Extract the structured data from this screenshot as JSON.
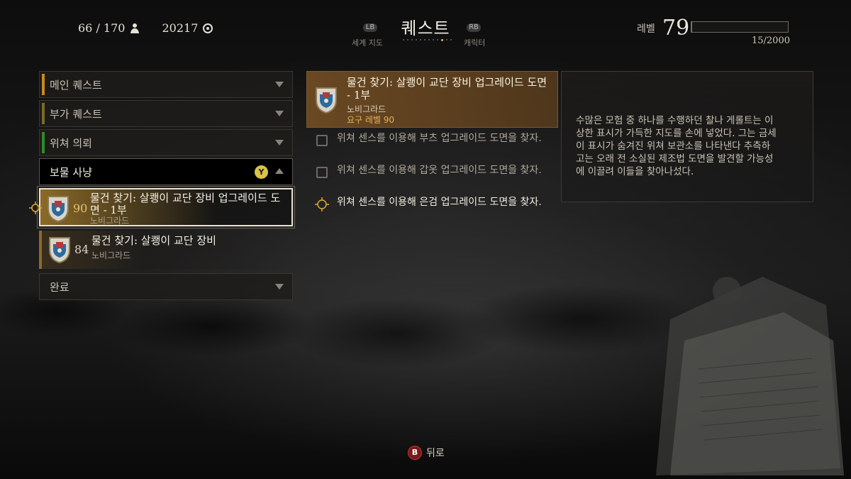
{
  "hud": {
    "inventory": "66 / 170",
    "gold": "20217",
    "title": "퀘스트",
    "nav_left_button": "LB",
    "nav_left_label": "세계 지도",
    "nav_right_button": "RB",
    "nav_right_label": "캐릭터",
    "level_label": "레벨",
    "level": "79",
    "xp": "15/2000",
    "xp_fraction": 0.0075
  },
  "categories": [
    {
      "label": "메인 퀘스트",
      "accent": "#c7891d"
    },
    {
      "label": "부가 퀘스트",
      "accent": "#7a6a28"
    },
    {
      "label": "위쳐 의뢰",
      "accent": "#2f8a2a"
    },
    {
      "label": "보물 사냥",
      "button": "Y"
    },
    {
      "label": "완료"
    }
  ],
  "quests": [
    {
      "level": "90",
      "name": "물건 찾기: 살쾡이 교단 장비 업그레이드 도면 - 1부",
      "location": "노비그라드"
    },
    {
      "level": "84",
      "name": "물건 찾기: 살쾡이 교단 장비",
      "location": "노비그라드"
    }
  ],
  "detail": {
    "title": "물건 찾기: 살쾡이 교단 장비 업그레이드 도면 - 1부",
    "location": "노비그라드",
    "required_level": "요구 레벨 90",
    "objectives": [
      "위쳐 센스를 이용해 부츠 업그레이드 도면을 찾자.",
      "위쳐 센스를 이용해 갑옷 업그레이드 도면을 찾자.",
      "위쳐 센스를 이용해 은검 업그레이드 도면을 찾자."
    ],
    "description": "수많은 모험 중 하나를 수행하던 찰나 게롤트는 이상한 표시가 가득한 지도를 손에 넣었다. 그는 금세 이 표시가 숨겨진 위쳐 보관소를 나타낸다 추측하고는 오래 전 소실된 제조법 도면을 발견할 가능성에 이끌려 이들을 찾아나섰다."
  },
  "footer": {
    "back_button": "B",
    "back_label": "뒤로"
  }
}
